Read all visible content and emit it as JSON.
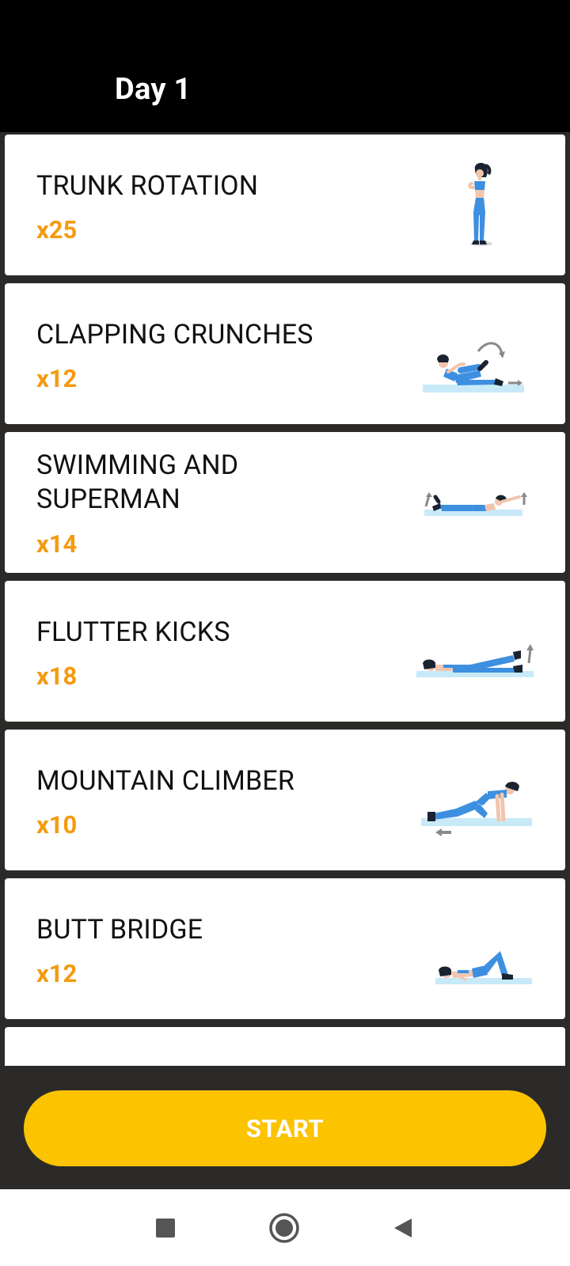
{
  "header": {
    "title": "Day 1"
  },
  "exercises": [
    {
      "name": "TRUNK ROTATION",
      "reps": "x25",
      "icon": "trunk-rotation-illustration"
    },
    {
      "name": "CLAPPING CRUNCHES",
      "reps": "x12",
      "icon": "clapping-crunches-illustration"
    },
    {
      "name": "SWIMMING AND SUPERMAN",
      "reps": "x14",
      "icon": "swimming-superman-illustration"
    },
    {
      "name": "FLUTTER KICKS",
      "reps": "x18",
      "icon": "flutter-kicks-illustration"
    },
    {
      "name": "MOUNTAIN CLIMBER",
      "reps": "x10",
      "icon": "mountain-climber-illustration"
    },
    {
      "name": "BUTT BRIDGE",
      "reps": "x12",
      "icon": "butt-bridge-illustration"
    }
  ],
  "footer": {
    "start_label": "START"
  },
  "system_nav": {
    "icons": [
      "recents-square-icon",
      "home-circle-icon",
      "back-triangle-icon"
    ]
  },
  "colors": {
    "header_bg": "#000000",
    "list_bg": "#2b2a28",
    "card_bg": "#ffffff",
    "reps_accent": "#f59a0f",
    "start_button": "#fbc300",
    "illustration_blue": "#3d8fe0",
    "mat_blue": "#c8eaf8"
  }
}
